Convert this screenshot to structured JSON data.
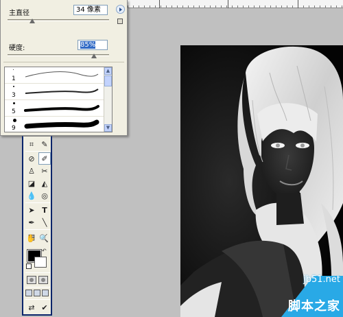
{
  "brush_panel": {
    "diameter_label": "主直径",
    "diameter_value": "34 像素",
    "hardness_label": "硬度:",
    "hardness_value": "85%",
    "diameter_level": 0.06,
    "hardness_level": 0.85,
    "presets": [
      {
        "num": "1"
      },
      {
        "num": "3"
      },
      {
        "num": "5"
      },
      {
        "num": "9"
      }
    ]
  },
  "toolbox": {
    "tools": [
      "crop-icon",
      "slice-icon",
      "healing-brush-icon",
      "brush-icon",
      "clone-stamp-icon",
      "history-brush-icon",
      "eraser-icon",
      "paint-bucket-icon",
      "blur-icon",
      "dodge-icon",
      "path-selection-icon",
      "type-icon",
      "pen-icon",
      "line-icon",
      "notes-icon",
      "eyedropper-icon",
      "hand-icon",
      "zoom-icon"
    ],
    "foreground_color": "#000000",
    "background_color": "#ffffff"
  },
  "image": {
    "description_colors": {
      "background": "#050505",
      "hair": "#e8e8e8",
      "skin": "#2a2a2a"
    }
  },
  "watermark": {
    "site": "jb51.net",
    "brand": "脚本之家",
    "color": "#29a9e6"
  }
}
